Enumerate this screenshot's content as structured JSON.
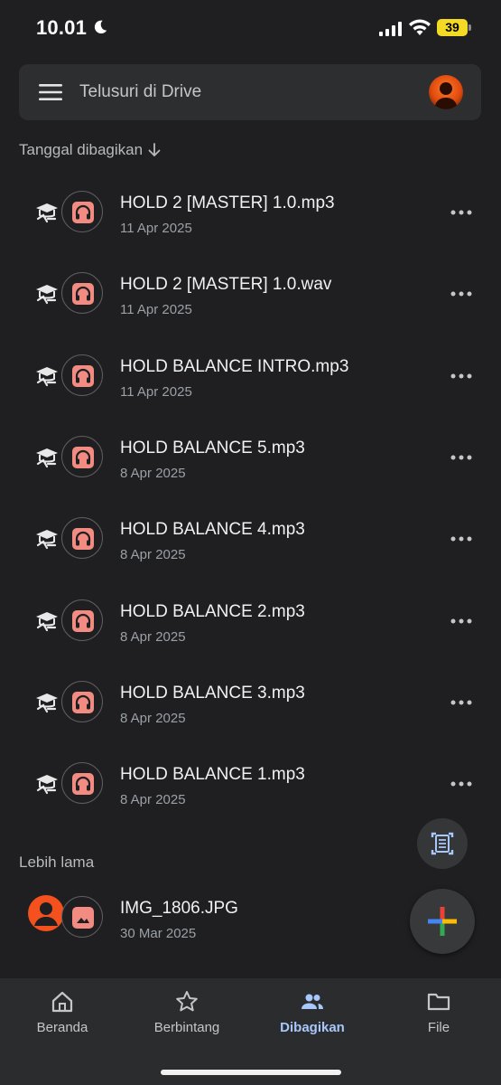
{
  "status_bar": {
    "time": "10.01",
    "battery": "39"
  },
  "search": {
    "placeholder": "Telusuri di Drive"
  },
  "sort": {
    "label": "Tanggal dibagikan"
  },
  "files": [
    {
      "name": "HOLD 2 [MASTER] 1.0.mp3",
      "date": "11 Apr 2025",
      "type_icon": "headphones-icon"
    },
    {
      "name": "HOLD 2 [MASTER] 1.0.wav",
      "date": "11 Apr 2025",
      "type_icon": "headphones-icon"
    },
    {
      "name": "HOLD BALANCE INTRO.mp3",
      "date": "11 Apr 2025",
      "type_icon": "headphones-icon"
    },
    {
      "name": "HOLD BALANCE 5.mp3",
      "date": "8 Apr 2025",
      "type_icon": "headphones-icon"
    },
    {
      "name": "HOLD BALANCE 4.mp3",
      "date": "8 Apr 2025",
      "type_icon": "headphones-icon"
    },
    {
      "name": "HOLD BALANCE 2.mp3",
      "date": "8 Apr 2025",
      "type_icon": "headphones-icon"
    },
    {
      "name": "HOLD BALANCE 3.mp3",
      "date": "8 Apr 2025",
      "type_icon": "headphones-icon"
    },
    {
      "name": "HOLD BALANCE 1.mp3",
      "date": "8 Apr 2025",
      "type_icon": "headphones-icon"
    }
  ],
  "older": {
    "label": "Lebih lama",
    "files": [
      {
        "name": "IMG_1806.JPG",
        "date": "30 Mar 2025",
        "type_icon": "image-icon"
      }
    ]
  },
  "nav": [
    {
      "label": "Beranda",
      "icon": "home-icon",
      "active": false
    },
    {
      "label": "Berbintang",
      "icon": "star-icon",
      "active": false
    },
    {
      "label": "Dibagikan",
      "icon": "people-icon",
      "active": true
    },
    {
      "label": "File",
      "icon": "folder-icon",
      "active": false
    }
  ],
  "colors": {
    "accent": "#a8c7fa",
    "file_badge": "#f28b82",
    "background": "#1f1f21"
  }
}
